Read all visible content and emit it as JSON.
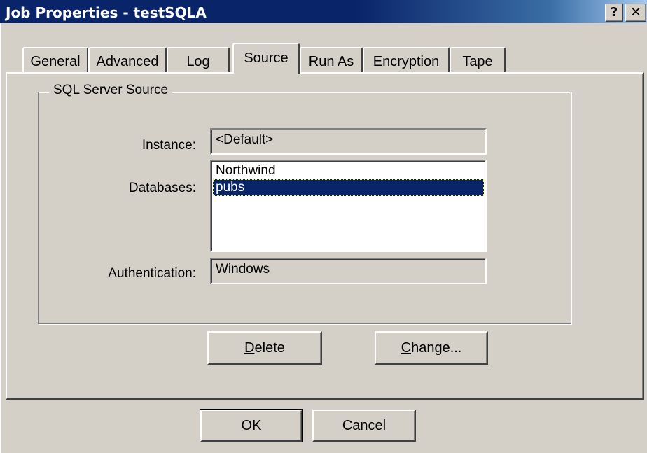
{
  "window": {
    "title": "Job Properties - testSQLA",
    "help_glyph": "?",
    "close_glyph": "✕"
  },
  "tabs": [
    {
      "label": "General"
    },
    {
      "label": "Advanced"
    },
    {
      "label": "Log"
    },
    {
      "label": "Source",
      "active": true
    },
    {
      "label": "Run As"
    },
    {
      "label": "Encryption"
    },
    {
      "label": "Tape"
    }
  ],
  "source": {
    "group_title": "SQL Server Source",
    "instance_label": "Instance:",
    "instance_value": "<Default>",
    "databases_label": "Databases:",
    "databases": [
      "Northwind",
      "pubs"
    ],
    "selected_database": "pubs",
    "authentication_label": "Authentication:",
    "authentication_value": "Windows",
    "delete_first": "D",
    "delete_rest": "elete",
    "change_first": "C",
    "change_rest": "hange..."
  },
  "footer": {
    "ok_label": "OK",
    "cancel_label": "Cancel"
  },
  "icons": {
    "help": "help-icon",
    "close": "close-icon"
  },
  "colors": {
    "titlebar": "#0a246a",
    "selection": "#0a246a",
    "face": "#d4d0c8"
  }
}
